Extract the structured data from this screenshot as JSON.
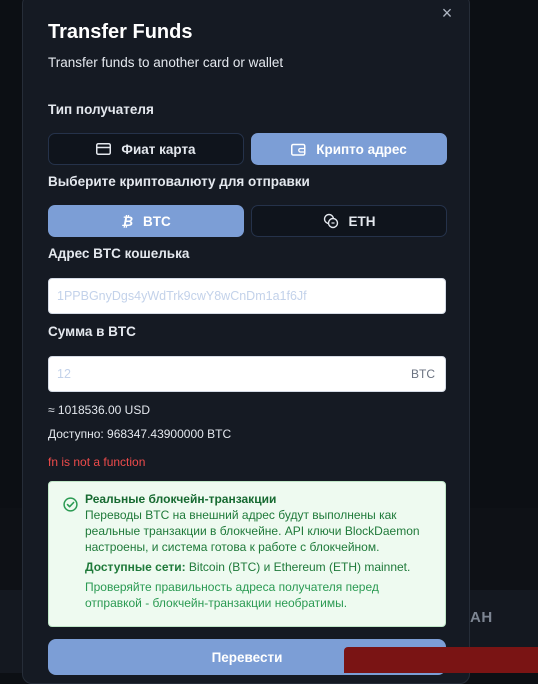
{
  "modal": {
    "title": "Transfer Funds",
    "subtitle": "Transfer funds to another card or wallet",
    "close_symbol": "×"
  },
  "recipient_type": {
    "label": "Тип получателя",
    "options": [
      {
        "label": "Фиат карта",
        "icon": "card-icon",
        "selected": false
      },
      {
        "label": "Крипто адрес",
        "icon": "wallet-icon",
        "selected": true
      }
    ]
  },
  "currency": {
    "label": "Выберите криптовалюту для отправки",
    "options": [
      {
        "label": "BTC",
        "icon": "bitcoin-icon",
        "selected": true
      },
      {
        "label": "ETH",
        "icon": "coins-icon",
        "selected": false
      }
    ]
  },
  "address": {
    "label": "Адрес BTC кошелька",
    "value": "",
    "placeholder": "1PPBGnyDgs4yWdTrk9cwY8wCnDm1a1f6Jf"
  },
  "amount": {
    "label": "Сумма в BTC",
    "value": "",
    "placeholder": "12",
    "suffix": "BTC"
  },
  "estimate": "≈ 1018536.00 USD",
  "available": "Доступно: 968347.43900000 BTC",
  "error": "fn is not a function",
  "notice": {
    "title": "Реальные блокчейн-транзакции",
    "body": "Переводы BTC на внешний адрес будут выполнены как реальные транзакции в блокчейне. API ключи BlockDaemon настроены, и система готова к работе с блокчейном.",
    "networks_label": "Доступные сети:",
    "networks_value": " Bitcoin (BTC) и Ethereum (ETH) mainnet.",
    "warning": "Проверяйте правильность адреса получателя перед отправкой - блокчейн-транзакции необратимы."
  },
  "submit_label": "Перевести",
  "background": {
    "partial_text": "АН"
  },
  "colors": {
    "modal_bg": "#151a23",
    "accent": "#7c9ed6",
    "error": "#ee4b4b",
    "success_bg": "#eefaf0",
    "success_text": "#1f7a3a",
    "toast": "#7a1414"
  }
}
